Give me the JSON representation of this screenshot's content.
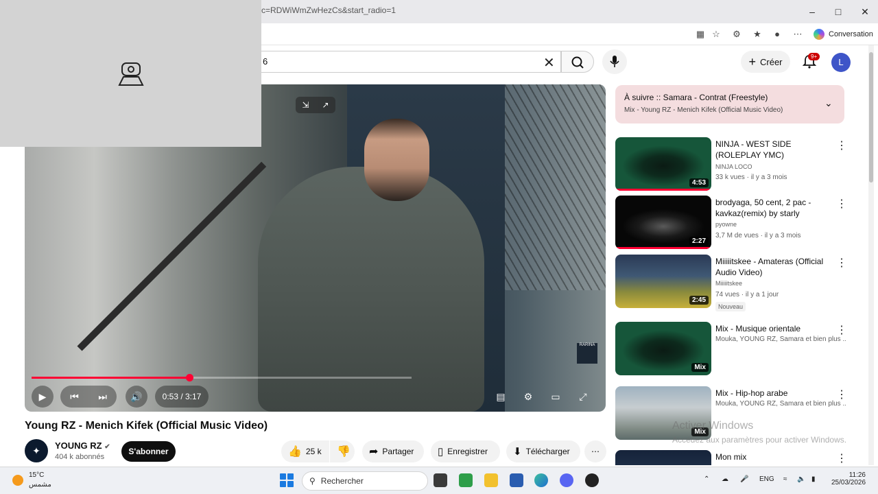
{
  "browser": {
    "url": "c=RDWiWmZwHezCs&start_radio=1",
    "conversation_label": "Conversation"
  },
  "header": {
    "search_value": "6",
    "create_label": "Créer",
    "notifications_badge": "9+",
    "avatar_letter": "L"
  },
  "player": {
    "current_time": "0:53 / 3:17",
    "progress_fraction": 0.415,
    "watermark": "RARINA"
  },
  "video": {
    "title": "Young RZ - Menich Kifek (Official Music Video)",
    "channel": "YOUNG RZ",
    "subscribers": "404 k abonnés",
    "subscribe_label": "S'abonner",
    "likes": "25 k",
    "share_label": "Partager",
    "save_label": "Enregistrer",
    "download_label": "Télécharger"
  },
  "up_next": {
    "title": "À suivre :: Samara - Contrat (Freestyle)",
    "subtitle": "Mix - Young RZ - Menich Kifek (Official Music Video)"
  },
  "recommendations": [
    {
      "title": "NINJA - WEST SIDE (ROLEPLAY YMC)",
      "channel": "NINJA LOCO",
      "meta": "33 k vues · il y a 3 mois",
      "duration": "4:53",
      "watched": 1.0
    },
    {
      "title": "brodyaga, 50 cent, 2 pac - kavkaz(remix) by starly",
      "channel": "pyowne",
      "meta": "3,7 M de vues · il y a 3 mois",
      "duration": "2:27",
      "watched": 1.0
    },
    {
      "title": "Miiiiitskee - Amateras (Official Audio Video)",
      "channel": "Miiiiitskee",
      "meta": "74 vues · il y a 1 jour",
      "duration": "2:45",
      "badge": "Nouveau"
    },
    {
      "title": "Mix - Musique orientale",
      "meta": "Mouka, YOUNG RZ, Samara et bien plus ...",
      "duration": "Mix"
    },
    {
      "title": "Mix - Hip-hop arabe",
      "meta": "Mouka, YOUNG RZ, Samara et bien plus ...",
      "duration": "Mix"
    },
    {
      "title": "Mon mix"
    }
  ],
  "windows": {
    "activate_title": "Activer Windows",
    "activate_sub": "Accédez aux paramètres pour activer Windows."
  },
  "taskbar": {
    "temperature": "15°C",
    "weather_desc": "مشمس",
    "search_placeholder": "Rechercher",
    "language": "ENG",
    "time": "11:26",
    "date": "25/03/2026"
  }
}
